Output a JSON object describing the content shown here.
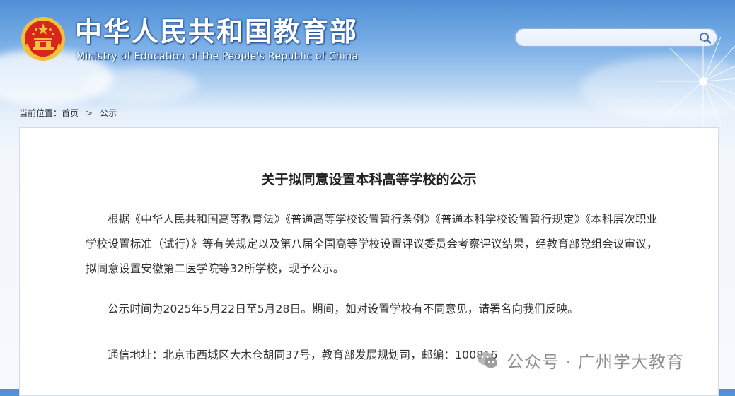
{
  "header": {
    "site_title": "中华人民共和国教育部",
    "site_subtitle": "Ministry of Education of the People's Republic of China",
    "search_placeholder": ""
  },
  "breadcrumb": {
    "prefix": "当前位置：",
    "home": "首页",
    "separator": ">",
    "current": "公示"
  },
  "article": {
    "title": "关于拟同意设置本科高等学校的公示",
    "paragraphs": [
      "根据《中华人民共和国高等教育法》《普通高等学校设置暂行条例》《普通本科学校设置暂行规定》《本科层次职业学校设置标准（试行）》等有关规定以及第八届全国高等学校设置评议委员会考察评议结果，经教育部党组会议审议，拟同意设置安徽第二医学院等32所学校，现予公示。",
      "公示时间为2025年5月22日至5月28日。期间，如对设置学校有不同意见，请署名向我们反映。",
      "通信地址：北京市西城区大木仓胡同37号，教育部发展规划司，邮编：100816"
    ]
  },
  "watermark": {
    "text": "公众号 · 广州学大教育"
  },
  "colors": {
    "header_blue": "#4f8fd6",
    "emblem_red": "#d8261c",
    "emblem_gold": "#f3c23c"
  }
}
